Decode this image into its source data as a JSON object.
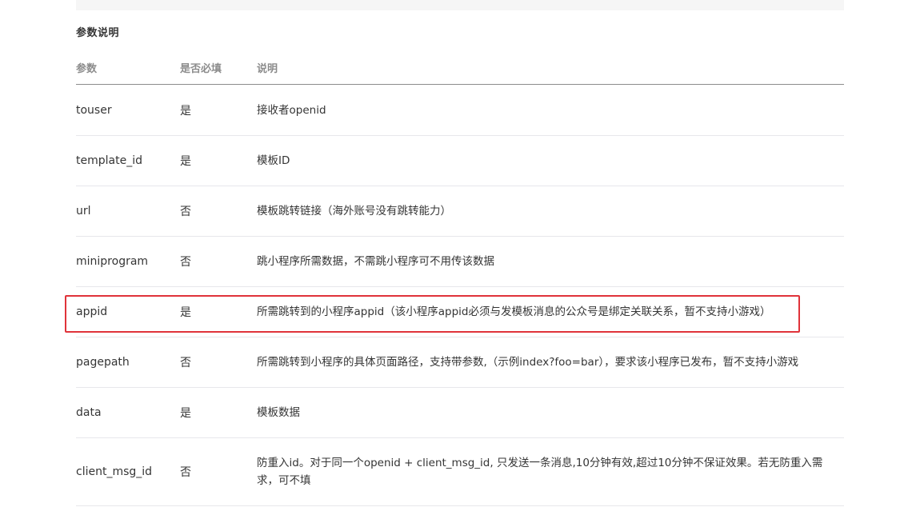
{
  "section_title": "参数说明",
  "table": {
    "headers": [
      "参数",
      "是否必填",
      "说明"
    ],
    "rows": [
      {
        "param": "touser",
        "required": "是",
        "desc": "接收者openid"
      },
      {
        "param": "template_id",
        "required": "是",
        "desc": "模板ID"
      },
      {
        "param": "url",
        "required": "否",
        "desc": "模板跳转链接（海外账号没有跳转能力）"
      },
      {
        "param": "miniprogram",
        "required": "否",
        "desc": "跳小程序所需数据，不需跳小程序可不用传该数据"
      },
      {
        "param": "appid",
        "required": "是",
        "desc": "所需跳转到的小程序appid（该小程序appid必须与发模板消息的公众号是绑定关联关系，暂不支持小游戏）"
      },
      {
        "param": "pagepath",
        "required": "否",
        "desc": "所需跳转到小程序的具体页面路径，支持带参数,（示例index?foo=bar），要求该小程序已发布，暂不支持小游戏"
      },
      {
        "param": "data",
        "required": "是",
        "desc": "模板数据"
      },
      {
        "param": "client_msg_id",
        "required": "否",
        "desc": "防重入id。对于同一个openid + client_msg_id, 只发送一条消息,10分钟有效,超过10分钟不保证效果。若无防重入需求，可不填"
      }
    ]
  },
  "highlight": {
    "row": "appid",
    "color": "#e0333a"
  }
}
